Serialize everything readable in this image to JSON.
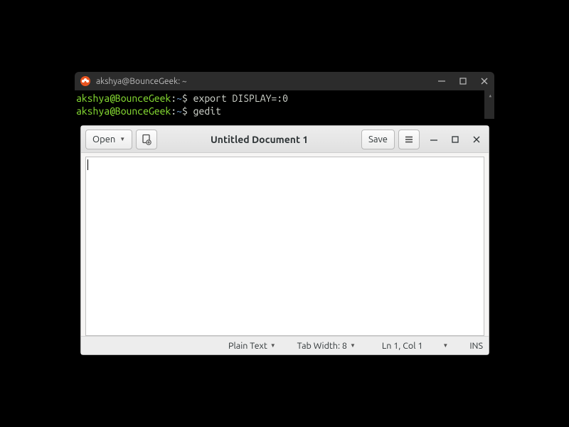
{
  "terminal": {
    "title": "akshya@BounceGeek: ~",
    "lines": [
      {
        "user": "akshya@BounceGeek",
        "cwd": "~",
        "cmd": "export DISPLAY=:0"
      },
      {
        "user": "akshya@BounceGeek",
        "cwd": "~",
        "cmd": "gedit"
      }
    ]
  },
  "gedit": {
    "header": {
      "open_label": "Open",
      "title": "Untitled Document 1",
      "save_label": "Save"
    },
    "status": {
      "syntax": "Plain Text",
      "tabwidth": "Tab Width: 8",
      "lncol": "Ln 1, Col 1",
      "ins": "INS"
    }
  }
}
